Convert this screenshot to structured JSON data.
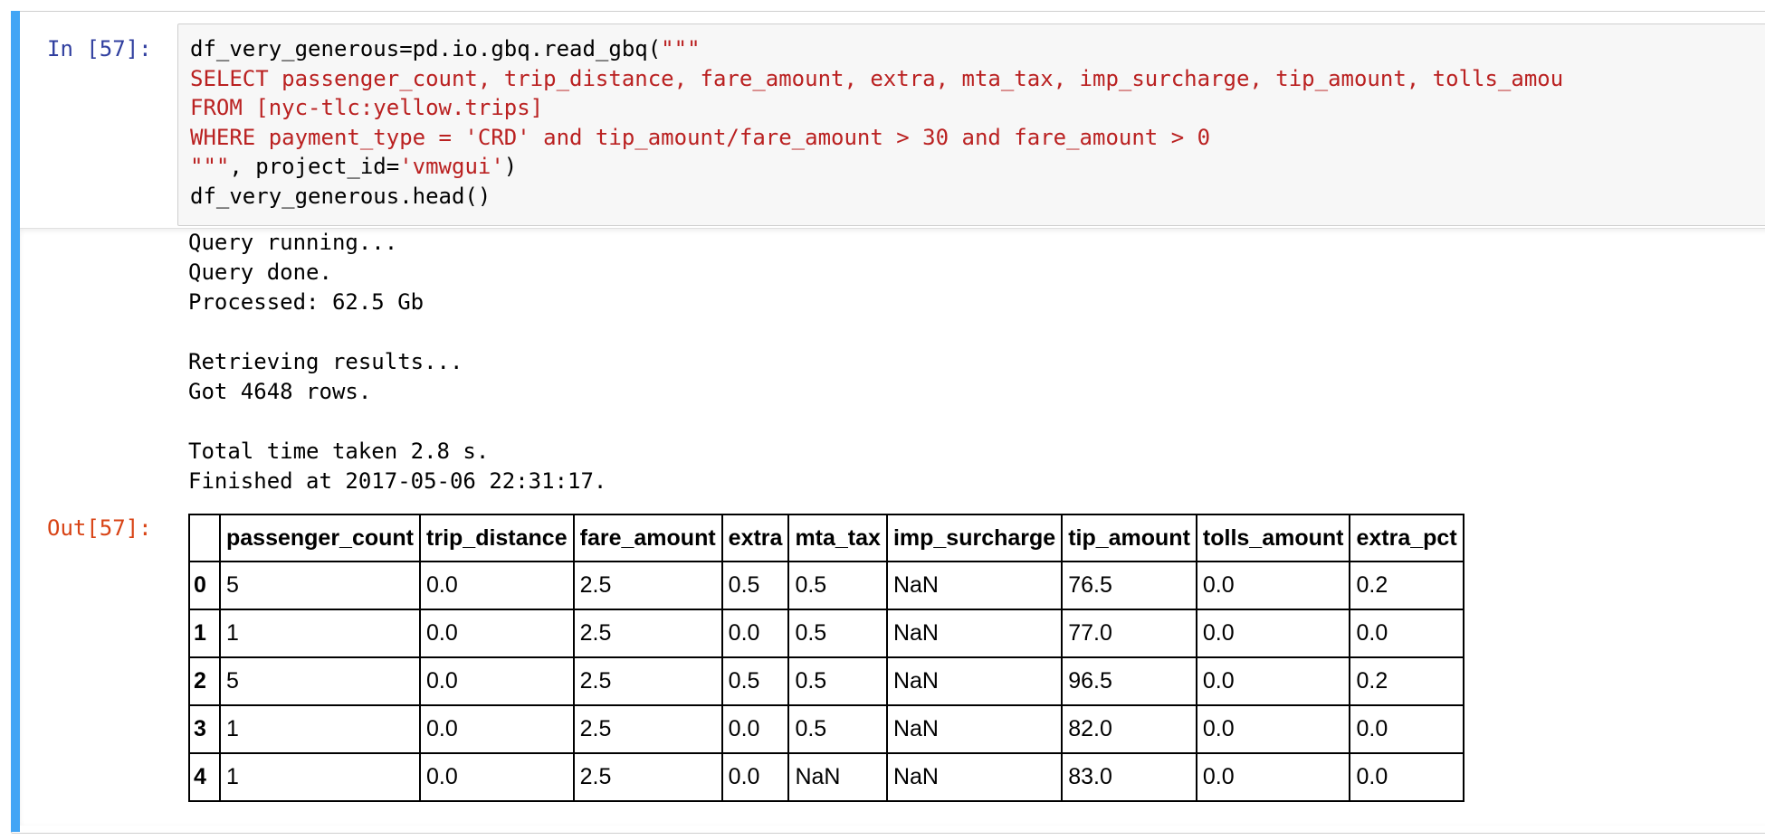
{
  "input": {
    "prompt": "In [57]:",
    "lines": [
      [
        {
          "t": "df_very_generous=pd.io.gbq.read_gbq(",
          "s": false
        },
        {
          "t": "\"\"\"",
          "s": true
        }
      ],
      [
        {
          "t": "SELECT passenger_count, trip_distance, fare_amount, extra, mta_tax, imp_surcharge, tip_amount, tolls_amou",
          "s": true
        }
      ],
      [
        {
          "t": "FROM [nyc-tlc:yellow.trips]",
          "s": true
        }
      ],
      [
        {
          "t": "WHERE payment_type = 'CRD' and tip_amount/fare_amount > 30 and fare_amount > 0",
          "s": true
        }
      ],
      [
        {
          "t": "\"\"\"",
          "s": true
        },
        {
          "t": ", project_id=",
          "s": false
        },
        {
          "t": "'vmwgui'",
          "s": true
        },
        {
          "t": ")",
          "s": false
        }
      ],
      [
        {
          "t": "df_very_generous.head()",
          "s": false
        }
      ]
    ]
  },
  "stream": {
    "lines": [
      "Query running...",
      "Query done.",
      "Processed: 62.5 Gb",
      "",
      "Retrieving results...",
      "Got 4648 rows.",
      "",
      "Total time taken 2.8 s.",
      "Finished at 2017-05-06 22:31:17."
    ]
  },
  "output": {
    "prompt": "Out[57]:"
  },
  "table": {
    "columns": [
      "passenger_count",
      "trip_distance",
      "fare_amount",
      "extra",
      "mta_tax",
      "imp_surcharge",
      "tip_amount",
      "tolls_amount",
      "extra_pct"
    ],
    "index": [
      "0",
      "1",
      "2",
      "3",
      "4"
    ],
    "rows": [
      [
        "5",
        "0.0",
        "2.5",
        "0.5",
        "0.5",
        "NaN",
        "76.5",
        "0.0",
        "0.2"
      ],
      [
        "1",
        "0.0",
        "2.5",
        "0.0",
        "0.5",
        "NaN",
        "77.0",
        "0.0",
        "0.0"
      ],
      [
        "5",
        "0.0",
        "2.5",
        "0.5",
        "0.5",
        "NaN",
        "96.5",
        "0.0",
        "0.2"
      ],
      [
        "1",
        "0.0",
        "2.5",
        "0.0",
        "0.5",
        "NaN",
        "82.0",
        "0.0",
        "0.0"
      ],
      [
        "1",
        "0.0",
        "2.5",
        "0.0",
        "NaN",
        "NaN",
        "83.0",
        "0.0",
        "0.0"
      ]
    ]
  },
  "colors": {
    "selected_cell_bar": "#42a5f5",
    "in_prompt": "#303f9f",
    "out_prompt": "#d84315",
    "string": "#ba2121",
    "input_bg": "#f7f7f7"
  }
}
